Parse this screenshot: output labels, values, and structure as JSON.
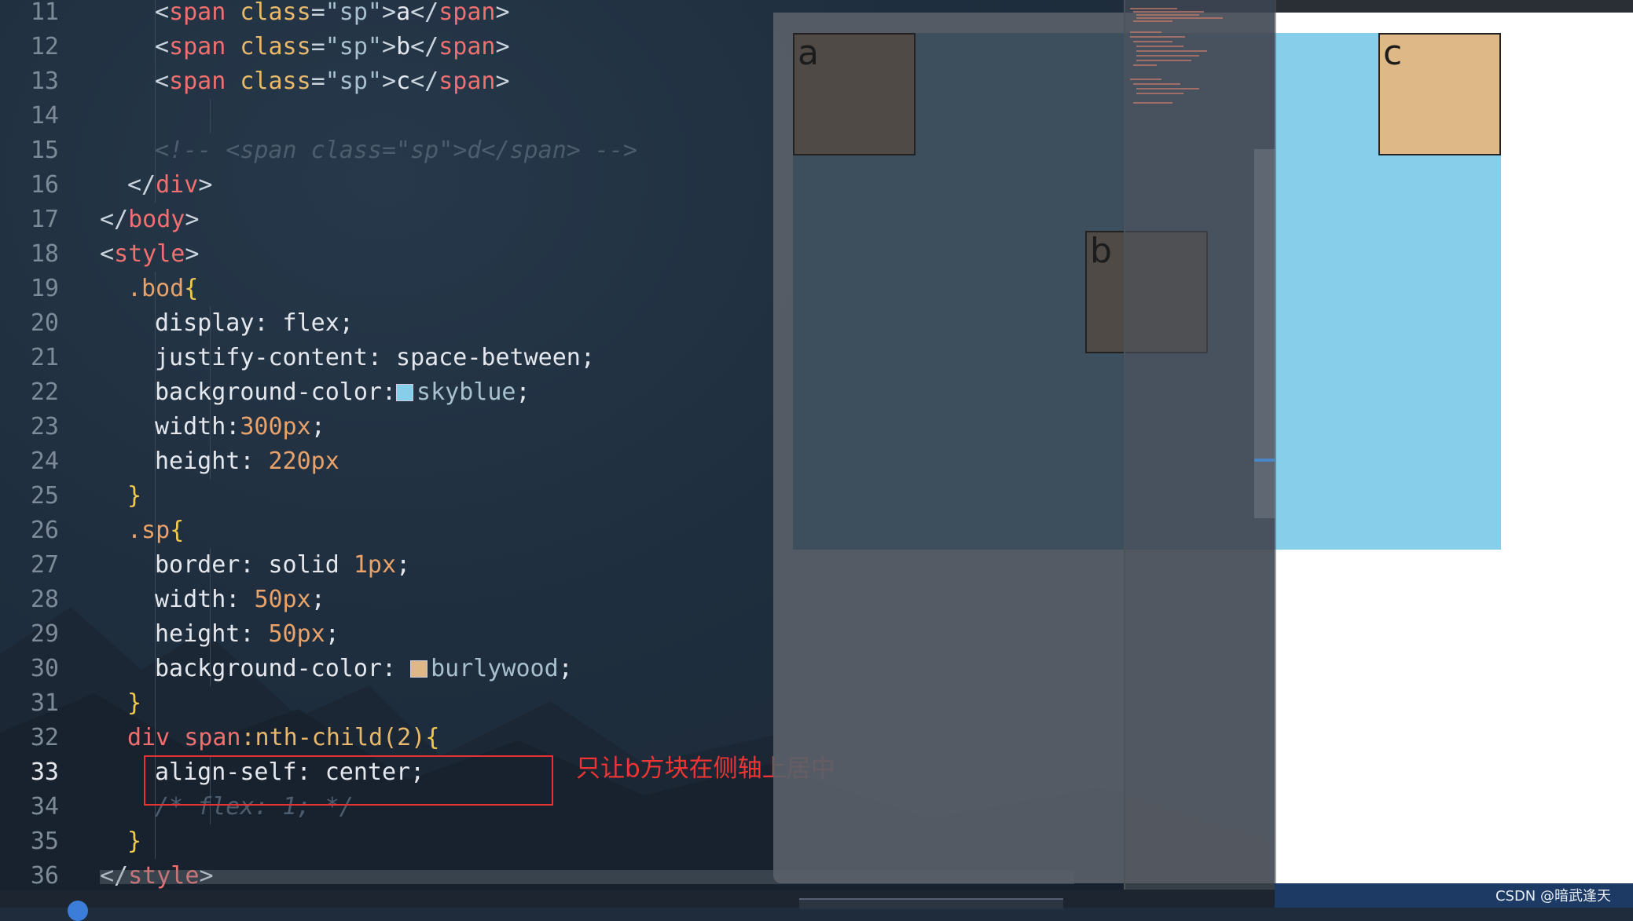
{
  "editor": {
    "lines": [
      {
        "n": "11",
        "indent": 4,
        "guides": [
          1
        ],
        "tokens": [
          {
            "c": "br",
            "t": "<"
          },
          {
            "c": "tag",
            "t": "span"
          },
          {
            "c": "attr",
            "t": " class"
          },
          {
            "c": "br",
            "t": "="
          },
          {
            "c": "str",
            "t": "\"sp\""
          },
          {
            "c": "br",
            "t": ">"
          },
          {
            "c": "txt",
            "t": "a"
          },
          {
            "c": "br",
            "t": "</"
          },
          {
            "c": "tag",
            "t": "span"
          },
          {
            "c": "br",
            "t": ">"
          }
        ]
      },
      {
        "n": "12",
        "indent": 4,
        "guides": [
          1
        ],
        "tokens": [
          {
            "c": "br",
            "t": "<"
          },
          {
            "c": "tag",
            "t": "span"
          },
          {
            "c": "attr",
            "t": " class"
          },
          {
            "c": "br",
            "t": "="
          },
          {
            "c": "str",
            "t": "\"sp\""
          },
          {
            "c": "br",
            "t": ">"
          },
          {
            "c": "txt",
            "t": "b"
          },
          {
            "c": "br",
            "t": "</"
          },
          {
            "c": "tag",
            "t": "span"
          },
          {
            "c": "br",
            "t": ">"
          }
        ]
      },
      {
        "n": "13",
        "indent": 4,
        "guides": [
          1
        ],
        "tokens": [
          {
            "c": "br",
            "t": "<"
          },
          {
            "c": "tag",
            "t": "span"
          },
          {
            "c": "attr",
            "t": " class"
          },
          {
            "c": "br",
            "t": "="
          },
          {
            "c": "str",
            "t": "\"sp\""
          },
          {
            "c": "br",
            "t": ">"
          },
          {
            "c": "txt",
            "t": "c"
          },
          {
            "c": "br",
            "t": "</"
          },
          {
            "c": "tag",
            "t": "span"
          },
          {
            "c": "br",
            "t": ">"
          }
        ]
      },
      {
        "n": "14",
        "indent": 0,
        "guides": [
          1,
          2
        ],
        "tokens": []
      },
      {
        "n": "15",
        "indent": 4,
        "guides": [
          1
        ],
        "tokens": [
          {
            "c": "cmt",
            "t": "<!-- <span class=\"sp\">d</span> -->"
          }
        ]
      },
      {
        "n": "16",
        "indent": 2,
        "guides": [
          1
        ],
        "tokens": [
          {
            "c": "br",
            "t": "</"
          },
          {
            "c": "tag",
            "t": "div"
          },
          {
            "c": "br",
            "t": ">"
          }
        ]
      },
      {
        "n": "17",
        "indent": 0,
        "guides": [],
        "tokens": [
          {
            "c": "br",
            "t": "</"
          },
          {
            "c": "tag",
            "t": "body"
          },
          {
            "c": "br",
            "t": ">"
          }
        ]
      },
      {
        "n": "18",
        "indent": 0,
        "guides": [],
        "tokens": [
          {
            "c": "br",
            "t": "<"
          },
          {
            "c": "tag",
            "t": "style"
          },
          {
            "c": "br",
            "t": ">"
          }
        ]
      },
      {
        "n": "19",
        "indent": 2,
        "guides": [
          1
        ],
        "tokens": [
          {
            "c": "sel",
            "t": ".bod"
          },
          {
            "c": "brace",
            "t": "{"
          }
        ]
      },
      {
        "n": "20",
        "indent": 4,
        "guides": [
          1,
          2
        ],
        "tokens": [
          {
            "c": "prop",
            "t": "display: flex;"
          }
        ]
      },
      {
        "n": "21",
        "indent": 4,
        "guides": [
          1,
          2
        ],
        "tokens": [
          {
            "c": "prop",
            "t": "justify-content: space-between;"
          }
        ]
      },
      {
        "n": "22",
        "indent": 4,
        "guides": [
          1,
          2
        ],
        "tokens": [
          {
            "c": "prop",
            "t": "background-color:"
          },
          {
            "c": "swatch",
            "t": "#87ceeb"
          },
          {
            "c": "str",
            "t": "skyblue"
          },
          {
            "c": "prop",
            "t": ";"
          }
        ]
      },
      {
        "n": "23",
        "indent": 4,
        "guides": [
          1,
          2
        ],
        "tokens": [
          {
            "c": "prop",
            "t": "width:"
          },
          {
            "c": "num",
            "t": "300px"
          },
          {
            "c": "prop",
            "t": ";"
          }
        ]
      },
      {
        "n": "24",
        "indent": 4,
        "guides": [
          1,
          2
        ],
        "tokens": [
          {
            "c": "prop",
            "t": "height: "
          },
          {
            "c": "num",
            "t": "220px"
          }
        ]
      },
      {
        "n": "25",
        "indent": 2,
        "guides": [
          1
        ],
        "tokens": [
          {
            "c": "brace",
            "t": "}"
          }
        ]
      },
      {
        "n": "26",
        "indent": 2,
        "guides": [
          1
        ],
        "tokens": [
          {
            "c": "sel",
            "t": ".sp"
          },
          {
            "c": "brace",
            "t": "{"
          }
        ]
      },
      {
        "n": "27",
        "indent": 4,
        "guides": [
          1,
          2
        ],
        "tokens": [
          {
            "c": "prop",
            "t": "border: solid "
          },
          {
            "c": "num",
            "t": "1px"
          },
          {
            "c": "prop",
            "t": ";"
          }
        ]
      },
      {
        "n": "28",
        "indent": 4,
        "guides": [
          1,
          2
        ],
        "tokens": [
          {
            "c": "prop",
            "t": "width: "
          },
          {
            "c": "num",
            "t": "50px"
          },
          {
            "c": "prop",
            "t": ";"
          }
        ]
      },
      {
        "n": "29",
        "indent": 4,
        "guides": [
          1,
          2
        ],
        "tokens": [
          {
            "c": "prop",
            "t": "height: "
          },
          {
            "c": "num",
            "t": "50px"
          },
          {
            "c": "prop",
            "t": ";"
          }
        ]
      },
      {
        "n": "30",
        "indent": 4,
        "guides": [
          1,
          2
        ],
        "tokens": [
          {
            "c": "prop",
            "t": "background-color: "
          },
          {
            "c": "swatch",
            "t": "#deb887"
          },
          {
            "c": "str",
            "t": "burlywood"
          },
          {
            "c": "prop",
            "t": ";"
          }
        ]
      },
      {
        "n": "31",
        "indent": 2,
        "guides": [
          1
        ],
        "tokens": [
          {
            "c": "brace",
            "t": "}"
          }
        ]
      },
      {
        "n": "32",
        "indent": 2,
        "guides": [
          1
        ],
        "tokens": [
          {
            "c": "tag",
            "t": "div"
          },
          {
            "c": "prop",
            "t": " "
          },
          {
            "c": "tag",
            "t": "span"
          },
          {
            "c": "attr",
            "t": ":nth-child(2)"
          },
          {
            "c": "brace",
            "t": "{"
          }
        ]
      },
      {
        "n": "33",
        "indent": 4,
        "guides": [
          1,
          2
        ],
        "tokens": [
          {
            "c": "prop",
            "t": "align-self: center;"
          }
        ]
      },
      {
        "n": "34",
        "indent": 4,
        "guides": [
          1,
          2
        ],
        "tokens": [
          {
            "c": "cmt",
            "t": "/* flex: 1; */"
          }
        ]
      },
      {
        "n": "35",
        "indent": 2,
        "guides": [
          1
        ],
        "tokens": [
          {
            "c": "brace",
            "t": "}"
          }
        ]
      },
      {
        "n": "36",
        "indent": 0,
        "guides": [],
        "tokens": [
          {
            "c": "br",
            "t": "</"
          },
          {
            "c": "tag",
            "t": "style"
          },
          {
            "c": "br",
            "t": ">"
          }
        ]
      }
    ],
    "active_line": "33"
  },
  "annotation": "只让b方块在侧轴上居中",
  "preview": {
    "boxes": {
      "a": "a",
      "b": "b",
      "c": "c"
    },
    "colors": {
      "container": "#87ceeb",
      "box": "#deb887"
    }
  },
  "watermark": "CSDN @暗武逢天"
}
